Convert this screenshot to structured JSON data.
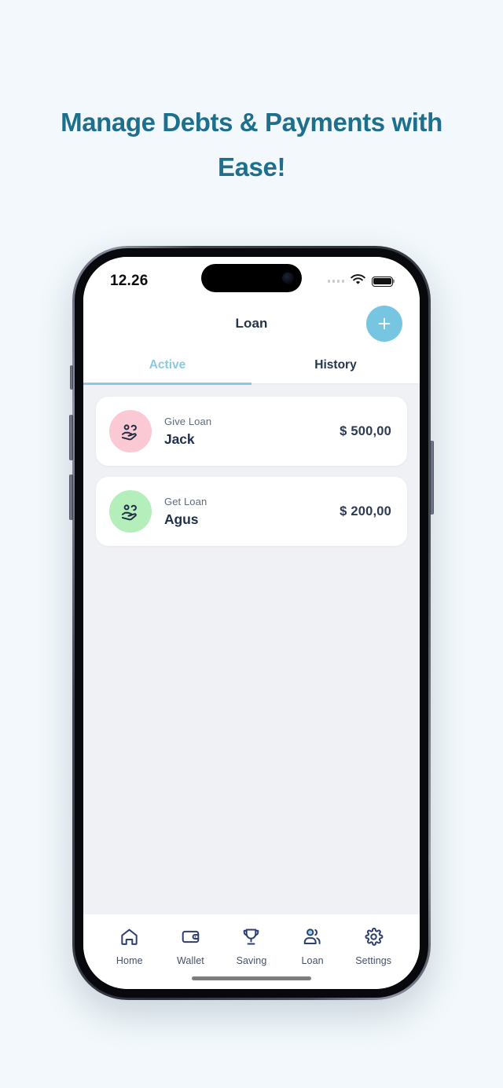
{
  "page": {
    "headline": "Manage Debts & Payments with Ease!",
    "background_color": "#f2f8fb",
    "headline_color": "#1e6f8c"
  },
  "status_bar": {
    "time": "12.26",
    "signal_icon": "signal-dots-icon",
    "wifi_icon": "wifi-icon",
    "battery_icon": "battery-full-icon"
  },
  "header": {
    "title": "Loan",
    "add_button_label": "+",
    "add_button_color": "#76c6e2"
  },
  "tabs": [
    {
      "label": "Active",
      "active": true
    },
    {
      "label": "History",
      "active": false
    }
  ],
  "loans": [
    {
      "type": "Give Loan",
      "name": "Jack",
      "amount": "$ 500,00",
      "avatar_color": "#fbc9d3",
      "icon": "hand-coins-icon"
    },
    {
      "type": "Get Loan",
      "name": "Agus",
      "amount": "$ 200,00",
      "avatar_color": "#b4eebb",
      "icon": "hand-coins-icon"
    }
  ],
  "bottom_nav": [
    {
      "label": "Home",
      "icon": "home-icon",
      "active": false
    },
    {
      "label": "Wallet",
      "icon": "wallet-icon",
      "active": false
    },
    {
      "label": "Saving",
      "icon": "trophy-icon",
      "active": false
    },
    {
      "label": "Loan",
      "icon": "users-icon",
      "active": true
    },
    {
      "label": "Settings",
      "icon": "gear-icon",
      "active": false
    }
  ]
}
